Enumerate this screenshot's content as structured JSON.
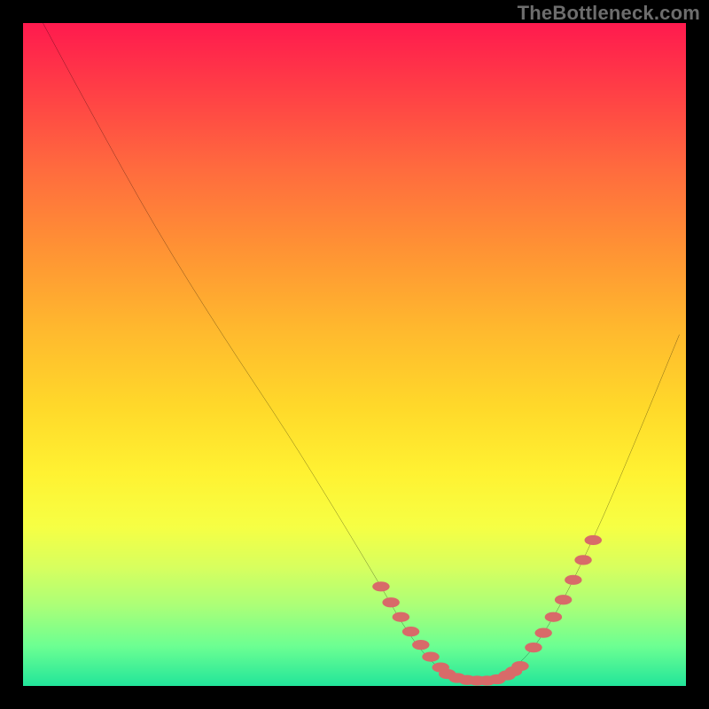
{
  "watermark": "TheBottleneck.com",
  "chart_data": {
    "type": "line",
    "title": "",
    "xlabel": "",
    "ylabel": "",
    "xlim": [
      0,
      100
    ],
    "ylim": [
      0,
      100
    ],
    "grid": false,
    "legend": false,
    "series": [
      {
        "name": "bottleneck-curve",
        "color": "#000000",
        "x": [
          3,
          10,
          20,
          30,
          40,
          48,
          54,
          58,
          62,
          66,
          70,
          75,
          80,
          86,
          92,
          99
        ],
        "y": [
          100,
          87,
          69,
          53,
          38,
          25,
          15,
          8,
          3,
          1,
          1,
          3,
          10,
          22,
          36,
          53
        ]
      }
    ],
    "highlight_segments": [
      {
        "name": "left-threshold-band",
        "color": "#d86a69",
        "x": [
          54,
          55.5,
          57,
          58.5,
          60,
          61.5,
          63
        ],
        "y": [
          15,
          12.6,
          10.4,
          8.2,
          6.2,
          4.4,
          2.8
        ]
      },
      {
        "name": "valley-band",
        "color": "#d86a69",
        "x": [
          64,
          65.5,
          67,
          68.5,
          70,
          71.5,
          73,
          74,
          75
        ],
        "y": [
          1.8,
          1.2,
          0.9,
          0.8,
          0.8,
          1.0,
          1.6,
          2.2,
          3.0
        ]
      },
      {
        "name": "right-threshold-band",
        "color": "#d86a69",
        "x": [
          77,
          78.5,
          80,
          81.5,
          83,
          84.5,
          86
        ],
        "y": [
          5.8,
          8.0,
          10.4,
          13.0,
          16.0,
          19.0,
          22.0
        ]
      }
    ],
    "annotations": []
  }
}
